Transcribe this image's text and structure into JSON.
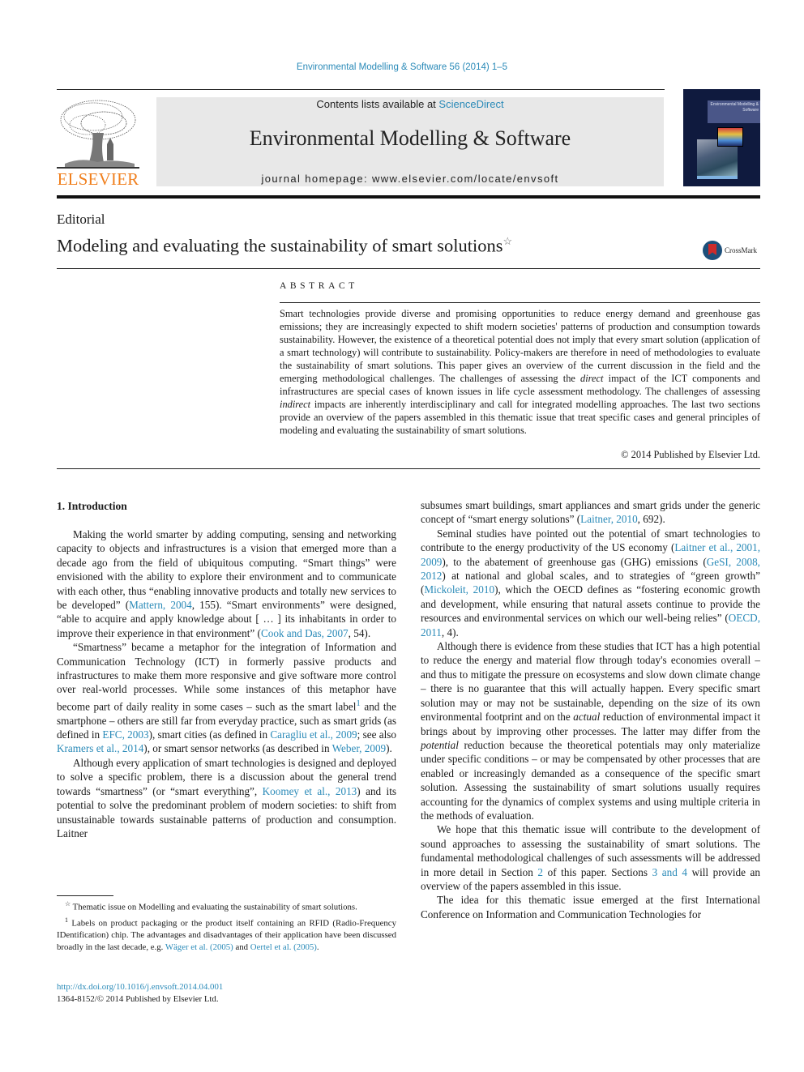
{
  "running_head": "Environmental Modelling & Software 56 (2014) 1–5",
  "publisher_logo": {
    "text": "ELSEVIER",
    "color": "#f07f1d"
  },
  "masthead": {
    "contents_prefix": "Contents lists available at ",
    "contents_link": "ScienceDirect",
    "journal_title": "Environmental Modelling & Software",
    "homepage": "journal homepage: www.elsevier.com/locate/envsoft"
  },
  "cover": {
    "title": "Environmental Modelling & Software"
  },
  "article": {
    "type": "Editorial",
    "title": "Modeling and evaluating the sustainability of smart solutions",
    "title_mark": "☆",
    "crossmark_label": "CrossMark"
  },
  "abstract": {
    "heading": "ABSTRACT",
    "parts": [
      "Smart technologies provide diverse and promising opportunities to reduce energy demand and greenhouse gas emissions; they are increasingly expected to shift modern societies' patterns of production and consumption towards sustainability. However, the existence of a theoretical potential does not imply that every smart solution (application of a smart technology) will contribute to sustainability. Policy-makers are therefore in need of methodologies to evaluate the sustainability of smart solutions. This paper gives an overview of the current discussion in the field and the emerging methodological challenges. The challenges of assessing the ",
      "direct",
      " impact of the ICT components and infrastructures are special cases of known issues in life cycle assessment methodology. The challenges of assessing ",
      "indirect",
      " impacts are inherently interdisciplinary and call for integrated modelling approaches. The last two sections provide an overview of the papers assembled in this thematic issue that treat specific cases and general principles of modeling and evaluating the sustainability of smart solutions."
    ],
    "copyright": "© 2014 Published by Elsevier Ltd."
  },
  "section1": {
    "heading": "1.  Introduction",
    "p1": {
      "t1": "Making the world smarter by adding computing, sensing and networking capacity to objects and infrastructures is a vision that emerged more than a decade ago from the field of ubiquitous computing. “Smart things” were envisioned with the ability to explore their environment and to communicate with each other, thus “enabling innovative products and totally new services to be developed” (",
      "l1": "Mattern, 2004",
      "t2": ", 155). “Smart environments” were designed, “able to acquire and apply knowledge about [ … ] its inhabitants in order to improve their experience in that environment” (",
      "l2": "Cook and Das, 2007",
      "t3": ", 54)."
    },
    "p2": {
      "t1": "“Smartness” became a metaphor for the integration of Information and Communication Technology (ICT) in formerly passive products and infrastructures to make them more responsive and give software more control over real-world processes. While some instances of this metaphor have become part of daily reality in some cases – such as the smart label",
      "fn": "1",
      "t2": " and the smartphone – others are still far from everyday practice, such as smart grids (as defined in ",
      "l1": "EFC, 2003",
      "t3": "), smart cities (as defined in ",
      "l2": "Caragliu et al., 2009",
      "t4": "; see also ",
      "l3": "Kramers et al., 2014",
      "t5": "), or smart sensor networks (as described in ",
      "l4": "Weber, 2009",
      "t6": ")."
    },
    "p3": {
      "t1": "Although every application of smart technologies is designed and deployed to solve a specific problem, there is a discussion about the general trend towards “smartness” (or “smart everything”, ",
      "l1": "Koomey et al., 2013",
      "t2": ") and its potential to solve the predominant problem of modern societies: to shift from unsustainable towards sustainable patterns of production and consumption. Laitner"
    },
    "p4": {
      "t1": "subsumes smart buildings, smart appliances and smart grids under the generic concept of “smart energy solutions” (",
      "l1": "Laitner, 2010",
      "t2": ", 692)."
    },
    "p5": {
      "t1": "Seminal studies have pointed out the potential of smart technologies to contribute to the energy productivity of the US economy (",
      "l1": "Laitner et al., 2001, 2009",
      "t2": "), to the abatement of greenhouse gas (GHG) emissions (",
      "l2": "GeSI, 2008, 2012",
      "t3": ") at national and global scales, and to strategies of “green growth” (",
      "l3": "Mickoleit, 2010",
      "t4": "), which the OECD defines as “fostering economic growth and development, while ensuring that natural assets continue to provide the resources and environmental services on which our well-being relies” (",
      "l4": "OECD, 2011",
      "t5": ", 4)."
    },
    "p6": {
      "t1": "Although there is evidence from these studies that ICT has a high potential to reduce the energy and material flow through today's economies overall – and thus to mitigate the pressure on ecosystems and slow down climate change – there is no guarantee that this will actually happen. Every specific smart solution may or may not be sustainable, depending on the size of its own environmental footprint and on the ",
      "i1": "actual",
      "t2": " reduction of environmental impact it brings about by improving other processes. The latter may differ from the ",
      "i2": "potential",
      "t3": " reduction because the theoretical potentials may only materialize under specific conditions – or may be compensated by other processes that are enabled or increasingly demanded as a consequence of the specific smart solution. Assessing the sustainability of smart solutions usually requires accounting for the dynamics of complex systems and using multiple criteria in the methods of evaluation."
    },
    "p7": {
      "t1": "We hope that this thematic issue will contribute to the development of sound approaches to assessing the sustainability of smart solutions. The fundamental methodological challenges of such assessments will be addressed in more detail in Section ",
      "l1": "2",
      "t2": " of this paper. Sections ",
      "l2": "3 and 4",
      "t3": " will provide an overview of the papers assembled in this issue."
    },
    "p8": {
      "t1": "The idea for this thematic issue emerged at the first International Conference on Information and Communication Technologies for"
    }
  },
  "footnotes": {
    "star": {
      "mark": "☆",
      "text": " Thematic issue on Modelling and evaluating the sustainability of smart solutions."
    },
    "fn1": {
      "mark": "1",
      "t1": " Labels on product packaging or the product itself containing an RFID (Radio-Frequency IDentification) chip. The advantages and disadvantages of their application have been discussed broadly in the last decade, e.g. ",
      "l1": "Wäger et al. (2005)",
      "t2": " and ",
      "l2": "Oertel et al. (2005)",
      "t3": "."
    }
  },
  "doi": {
    "link": "http://dx.doi.org/10.1016/j.envsoft.2014.04.001",
    "issn_line": "1364-8152/© 2014 Published by Elsevier Ltd."
  },
  "colors": {
    "link": "#2a8ab8",
    "elsevier_orange": "#f07f1d",
    "masthead_bg": "#e8e8e8"
  }
}
